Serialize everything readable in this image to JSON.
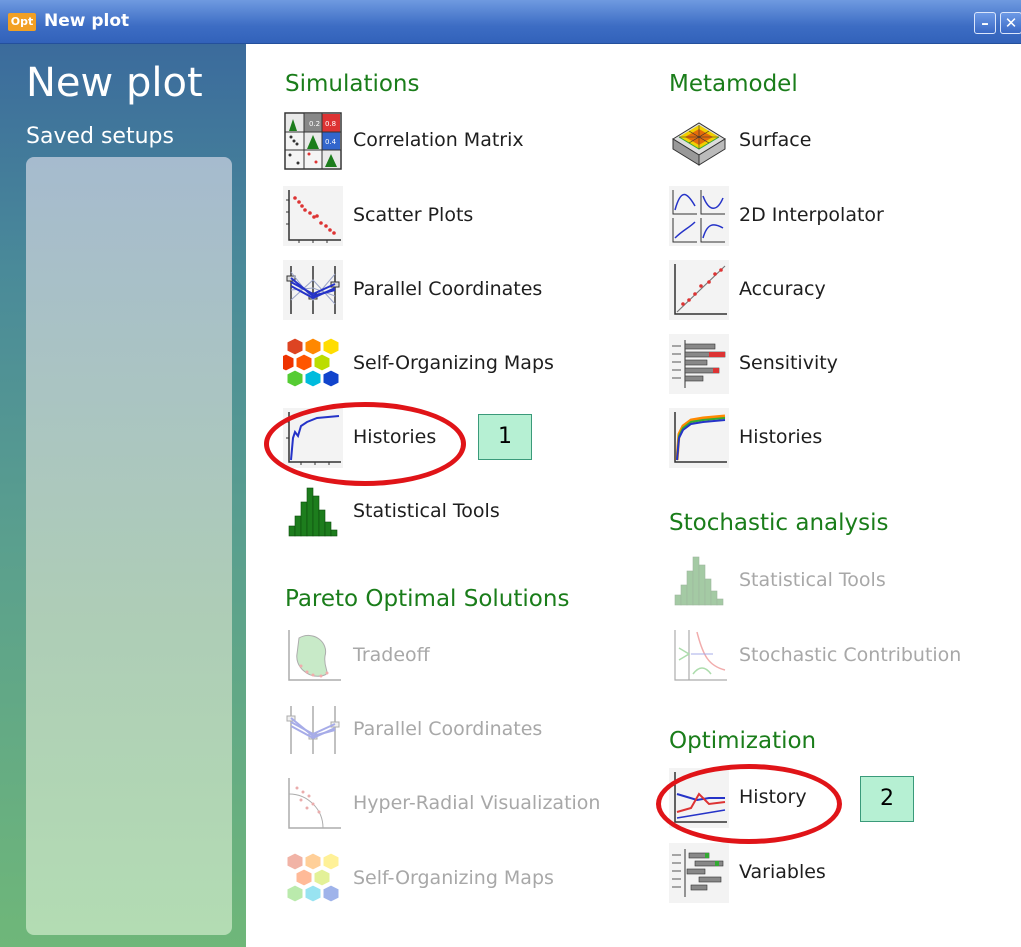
{
  "window": {
    "logo_text": "Opt",
    "title": "New plot",
    "minimize_label": "–",
    "close_label": "✕"
  },
  "sidebar": {
    "title": "New plot",
    "subtitle": "Saved setups"
  },
  "simulations": {
    "heading": "Simulations",
    "items": [
      {
        "label": "Correlation Matrix",
        "icon": "correlation-matrix-icon"
      },
      {
        "label": "Scatter Plots",
        "icon": "scatter-plot-icon"
      },
      {
        "label": "Parallel Coordinates",
        "icon": "parallel-coordinates-icon"
      },
      {
        "label": "Self-Organizing Maps",
        "icon": "hexagon-map-icon"
      },
      {
        "label": "Histories",
        "icon": "history-curve-icon"
      },
      {
        "label": "Statistical Tools",
        "icon": "histogram-icon"
      }
    ]
  },
  "pareto": {
    "heading": "Pareto Optimal Solutions",
    "items": [
      {
        "label": "Tradeoff",
        "icon": "tradeoff-icon",
        "enabled": false
      },
      {
        "label": "Parallel Coordinates",
        "icon": "parallel-coordinates-icon",
        "enabled": false
      },
      {
        "label": "Hyper-Radial Visualization",
        "icon": "hyper-radial-icon",
        "enabled": false
      },
      {
        "label": "Self-Organizing Maps",
        "icon": "hexagon-map-icon",
        "enabled": false
      }
    ]
  },
  "metamodel": {
    "heading": "Metamodel",
    "items": [
      {
        "label": "Surface",
        "icon": "surface-3d-icon"
      },
      {
        "label": "2D Interpolator",
        "icon": "interpolator-icon"
      },
      {
        "label": "Accuracy",
        "icon": "accuracy-icon"
      },
      {
        "label": "Sensitivity",
        "icon": "sensitivity-bars-icon"
      },
      {
        "label": "Histories",
        "icon": "multi-history-icon"
      }
    ]
  },
  "stochastic": {
    "heading": "Stochastic analysis",
    "items": [
      {
        "label": "Statistical Tools",
        "icon": "histogram-icon",
        "enabled": false
      },
      {
        "label": "Stochastic Contribution",
        "icon": "stochastic-contribution-icon",
        "enabled": false
      }
    ]
  },
  "optimization": {
    "heading": "Optimization",
    "items": [
      {
        "label": "History",
        "icon": "optimization-history-icon"
      },
      {
        "label": "Variables",
        "icon": "variables-bars-icon"
      }
    ]
  },
  "annotations": {
    "badge_1": "1",
    "badge_2": "2",
    "highlight_color": "#e01418",
    "badge_color": "#b6f0d3"
  },
  "colors": {
    "section_heading": "#1a7d1a",
    "disabled_text": "#a8a8a8",
    "titlebar": "#3d6dc4"
  }
}
